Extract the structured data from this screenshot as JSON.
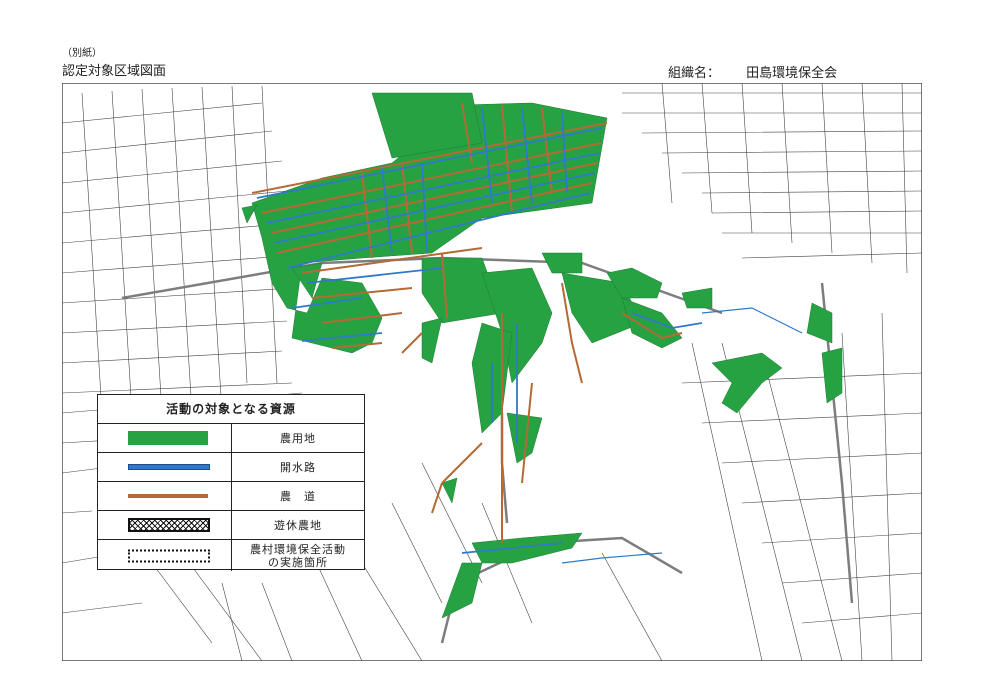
{
  "header": {
    "note": "（別紙）",
    "title": "認定対象区域図面",
    "org_label": "組織名：",
    "org_name": "田島環境保全会"
  },
  "legend": {
    "title": "活動の対象となる資源",
    "items": [
      {
        "label": "農用地",
        "symbol": "farmland-fill",
        "color": "#27a243"
      },
      {
        "label": "開水路",
        "symbol": "waterway-line",
        "color": "#2f79c8"
      },
      {
        "label": "農　道",
        "symbol": "farm-road-line",
        "color": "#b46a36"
      },
      {
        "label": "遊休農地",
        "symbol": "idle-farmland-hatch",
        "color": "#111111"
      },
      {
        "label": "農村環境保全活動\nの実施箇所",
        "symbol": "implementation-dotted-box",
        "color": "#111111"
      }
    ]
  },
  "map": {
    "colors": {
      "farmland": "#27a243",
      "waterway": "#2f79c8",
      "farm_road": "#b46a36",
      "base_lines": "#333333",
      "gray_road": "#7d7d80"
    }
  }
}
